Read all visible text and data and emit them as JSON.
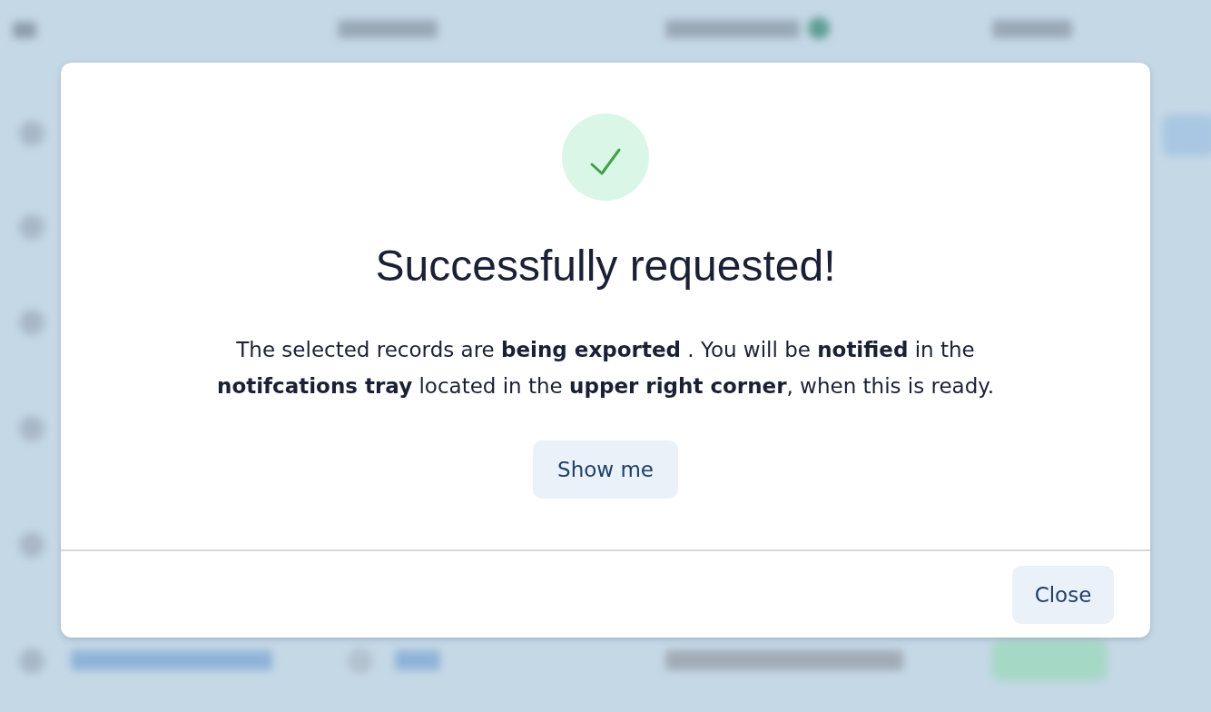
{
  "modal": {
    "title": "Successfully requested!",
    "message": "The selected records are **being exported** . You will be **notified** in the **notifcations tray** located in the **upper right corner**, when this is ready.",
    "primary_action": "Show me",
    "footer_buttons": [
      "Close"
    ]
  }
}
